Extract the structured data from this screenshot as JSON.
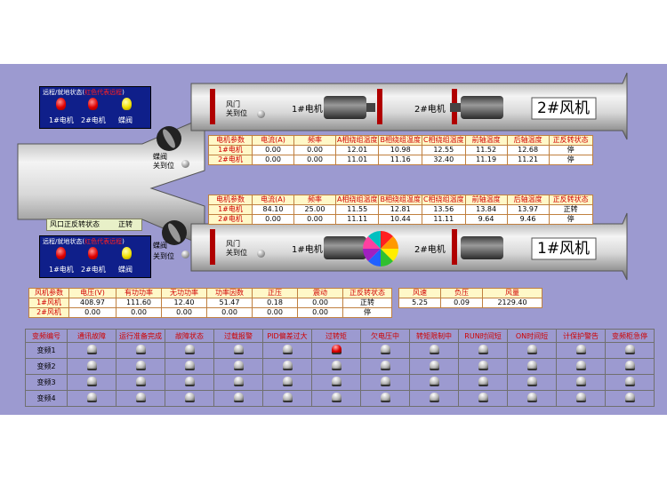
{
  "top_panel": {
    "title_prefix": "远程/就地状态(",
    "title_red": "红色代表远程",
    "title_suffix": ")",
    "lamps": [
      {
        "label": "1#电机",
        "color": "red"
      },
      {
        "label": "2#电机",
        "color": "red"
      },
      {
        "label": "蝶阀",
        "color": "yellow"
      }
    ]
  },
  "bottom_panel": {
    "title_prefix": "远程/就地状态(",
    "title_red": "红色代表远程",
    "title_suffix": ")",
    "lamps": [
      {
        "label": "1#电机",
        "color": "red"
      },
      {
        "label": "2#电机",
        "color": "red"
      },
      {
        "label": "蝶阀",
        "color": "yellow"
      }
    ]
  },
  "top_duct": {
    "damper_label_1": "风门",
    "damper_label_2": "关到位",
    "motor1_label": "1#电机",
    "motor2_label": "2#电机",
    "fan_label": "2#风机",
    "valve_label_1": "蝶阀",
    "valve_label_2": "关到位"
  },
  "bottom_duct": {
    "damper_label_1": "风门",
    "damper_label_2": "关到位",
    "motor1_label": "1#电机",
    "motor2_label": "2#电机",
    "fan_label": "1#风机",
    "valve_label_1": "蝶阀",
    "valve_label_2": "关到位"
  },
  "wind_status": {
    "label": "风口正反转状态",
    "value": "正转"
  },
  "motor_table_headers": [
    "电机参数",
    "电流(A)",
    "频率",
    "A相绕组温度",
    "B相绕组温度",
    "C相绕组温度",
    "前轴温度",
    "后轴温度",
    "正反转状态"
  ],
  "motor_table_top": [
    [
      "1#电机",
      "0.00",
      "0.00",
      "12.01",
      "10.98",
      "12.55",
      "11.52",
      "12.68",
      "停"
    ],
    [
      "2#电机",
      "0.00",
      "0.00",
      "11.01",
      "11.16",
      "32.40",
      "11.19",
      "11.21",
      "停"
    ]
  ],
  "motor_table_bottom": [
    [
      "1#电机",
      "84.10",
      "25.00",
      "11.55",
      "12.81",
      "13.56",
      "13.84",
      "13.97",
      "正转"
    ],
    [
      "2#电机",
      "0.00",
      "0.00",
      "11.11",
      "10.44",
      "11.11",
      "9.64",
      "9.46",
      "停"
    ]
  ],
  "fan_params": {
    "headers": [
      "风机参数",
      "电压(V)",
      "有功功率",
      "无功功率",
      "功率因数",
      "正压",
      "震动",
      "正反转状态"
    ],
    "rows": [
      [
        "1#风机",
        "408.97",
        "111.60",
        "12.40",
        "51.47",
        "0.18",
        "0.00",
        "正转"
      ],
      [
        "2#风机",
        "0.00",
        "0.00",
        "0.00",
        "0.00",
        "0.00",
        "0.00",
        "停"
      ]
    ],
    "extra_headers": [
      "风速",
      "负压",
      "风量"
    ],
    "extra_values": [
      "5.25",
      "0.09",
      "2129.40"
    ]
  },
  "fault_table": {
    "headers": [
      "变频编号",
      "通讯故障",
      "运行准备完成",
      "故障状态",
      "过载报警",
      "PID偏差过大",
      "过转矩",
      "欠电压中",
      "转矩限制中",
      "RUN时间短",
      "ON时间短",
      "计保护警告",
      "变频柜急停"
    ],
    "rows": [
      {
        "name": "变频1",
        "states": [
          0,
          0,
          0,
          0,
          0,
          1,
          0,
          0,
          0,
          0,
          0,
          0
        ]
      },
      {
        "name": "变频2",
        "states": [
          0,
          0,
          0,
          0,
          0,
          0,
          0,
          0,
          0,
          0,
          0,
          0
        ]
      },
      {
        "name": "变频3",
        "states": [
          0,
          0,
          0,
          0,
          0,
          0,
          0,
          0,
          0,
          0,
          0,
          0
        ]
      },
      {
        "name": "变频4",
        "states": [
          0,
          0,
          0,
          0,
          0,
          0,
          0,
          0,
          0,
          0,
          0,
          0
        ]
      }
    ]
  },
  "colors": {
    "background": "#9c9ad0",
    "duct": "#d8d8d8",
    "accent_red": "#d00000",
    "panel_blue": "#0f1f8a"
  }
}
